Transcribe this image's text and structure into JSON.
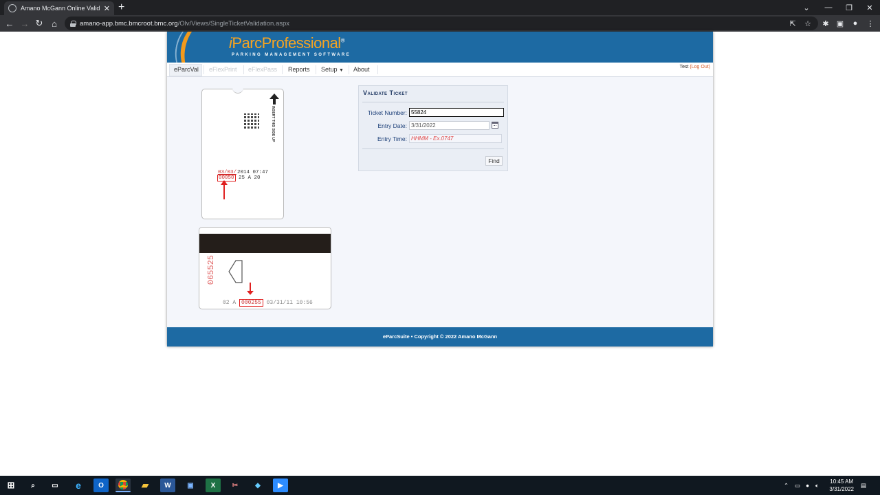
{
  "browser": {
    "tab_title": "Amano McGann Online Validatio",
    "tab_close": "✕",
    "new_tab": "+",
    "url_host": "amano-app.bmc.bmcroot.bmc.org",
    "url_path": "/Olv/Views/SingleTicketValidation.aspx",
    "window_controls": [
      "⌄",
      "—",
      "❐",
      "✕"
    ]
  },
  "app": {
    "logo_prefix": "i",
    "logo_main": "ParcProfessional",
    "logo_mark": "®",
    "logo_subtitle": "PARKING MANAGEMENT SOFTWARE",
    "menu": {
      "items": [
        {
          "label": "eParcVal",
          "disabled": false
        },
        {
          "label": "eFlexPrint",
          "disabled": true
        },
        {
          "label": "eFlexPass",
          "disabled": true
        },
        {
          "label": "Reports",
          "disabled": false
        },
        {
          "label": "Setup",
          "disabled": false
        },
        {
          "label": "About",
          "disabled": false
        }
      ],
      "setup_caret": "▼"
    },
    "user": {
      "name": "Test",
      "logout": "(Log Out)"
    },
    "ticket1": {
      "side_text": "INSERT THIS SIDE UP",
      "line1_date": "03/03/",
      "line1_rest": "2014 07:47",
      "line2_num": "00050",
      "line2_rest": " 25 A 20"
    },
    "ticket2": {
      "serial": "065525",
      "bottom_pre": "02 A ",
      "bottom_num": "000255",
      "bottom_post": " 03/31/11 10:56"
    },
    "validate": {
      "title": "Validate Ticket",
      "ticket_number_label": "Ticket Number:",
      "ticket_number_value": "55824",
      "entry_date_label": "Entry Date:",
      "entry_date_value": "3/31/2022",
      "entry_time_label": "Entry Time:",
      "entry_time_placeholder": "HHMM - Ex.0747",
      "find_button": "Find"
    },
    "footer": "eParcSuite • Copyright © 2022 Amano McGann"
  },
  "taskbar": {
    "apps": [
      "windows-start",
      "search",
      "task-view",
      "edge",
      "outlook",
      "chrome",
      "file-explorer",
      "word",
      "remote",
      "excel",
      "app",
      "teams-ish",
      "zoom"
    ],
    "time": "10:45 AM",
    "date": "3/31/2022"
  }
}
